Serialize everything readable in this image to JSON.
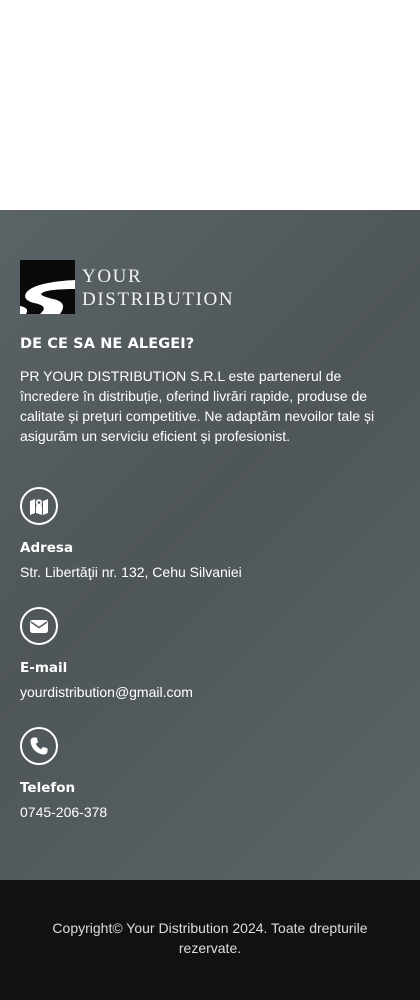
{
  "brand": {
    "logo_line1": "YOUR",
    "logo_line2": "DISTRIBUTION"
  },
  "about": {
    "heading": "DE CE SA NE ALEGEI?",
    "text": "PR YOUR DISTRIBUTION S.R.L este partenerul de încredere în distribuție, oferind livrări rapide, produse de calitate și prețuri competitive. Ne adaptăm nevoilor tale și asigurăm un serviciu eficient și profesionist."
  },
  "contact": {
    "address": {
      "label": "Adresa",
      "value": "Str. Libertăţii nr. 132, Cehu Silvaniei",
      "icon": "map-icon"
    },
    "email": {
      "label": "E-mail",
      "value": "yourdistribution@gmail.com",
      "icon": "envelope-icon"
    },
    "phone": {
      "label": "Telefon",
      "value": "0745-206-378",
      "icon": "phone-icon"
    }
  },
  "footer": {
    "copyright": "Copyright© Your Distribution 2024. Toate drepturile rezervate."
  },
  "colors": {
    "footer_bg": "#565e61",
    "bottom_bar_bg": "#111111",
    "text": "#ffffff"
  }
}
